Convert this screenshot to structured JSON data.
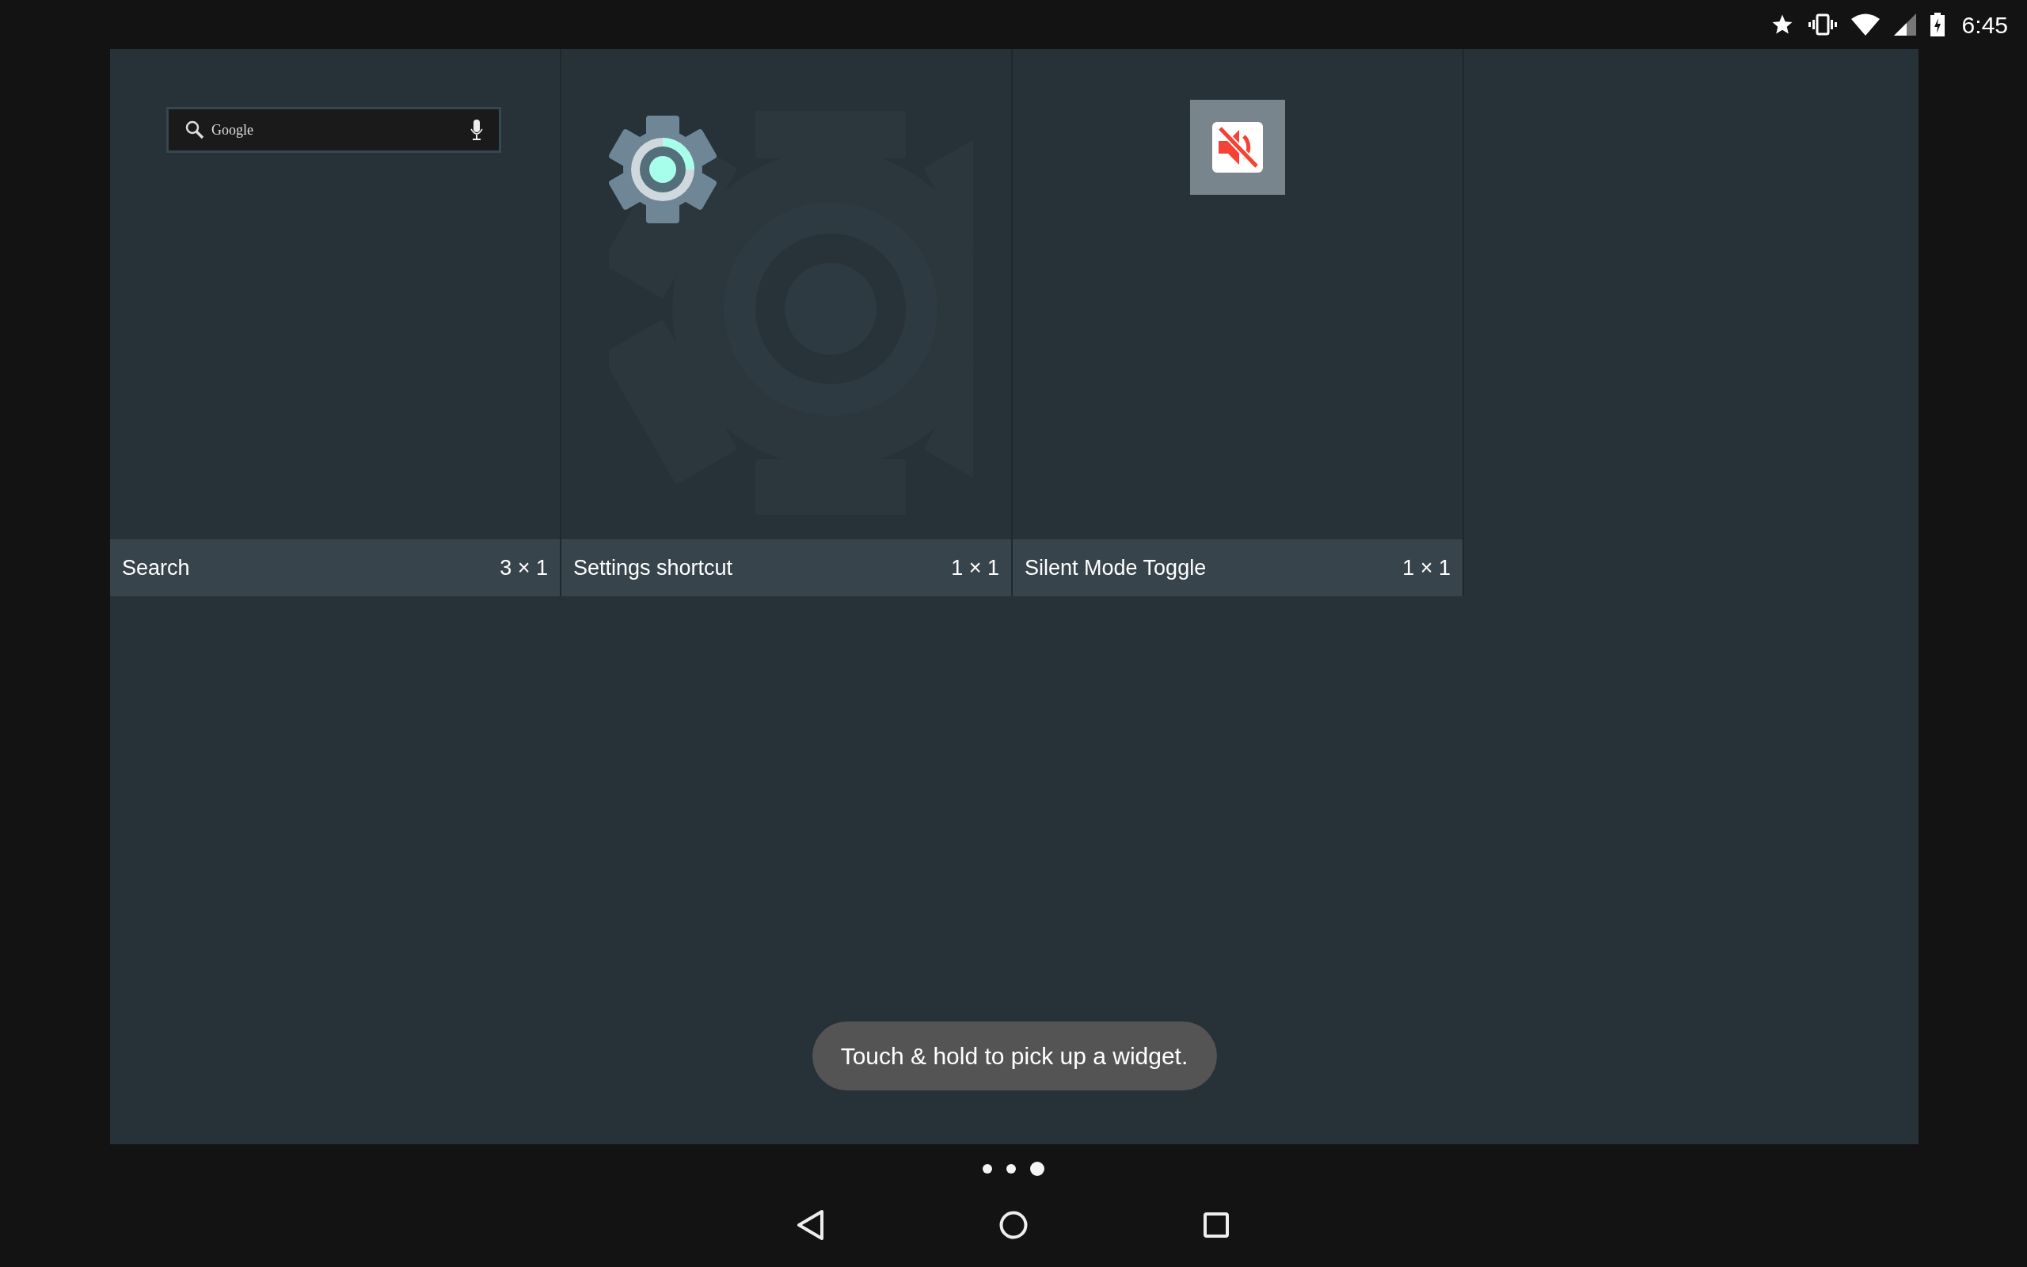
{
  "status_bar": {
    "time": "6:45"
  },
  "widgets": [
    {
      "kind": "search",
      "name": "Search",
      "size": "3 × 1",
      "preview_text": "Google"
    },
    {
      "kind": "settings",
      "name": "Settings shortcut",
      "size": "1 × 1"
    },
    {
      "kind": "silent",
      "name": "Silent Mode Toggle",
      "size": "1 × 1"
    }
  ],
  "toast": "Touch & hold to pick up a widget.",
  "pages": [
    {
      "selected": false
    },
    {
      "selected": false
    },
    {
      "selected": true
    }
  ]
}
